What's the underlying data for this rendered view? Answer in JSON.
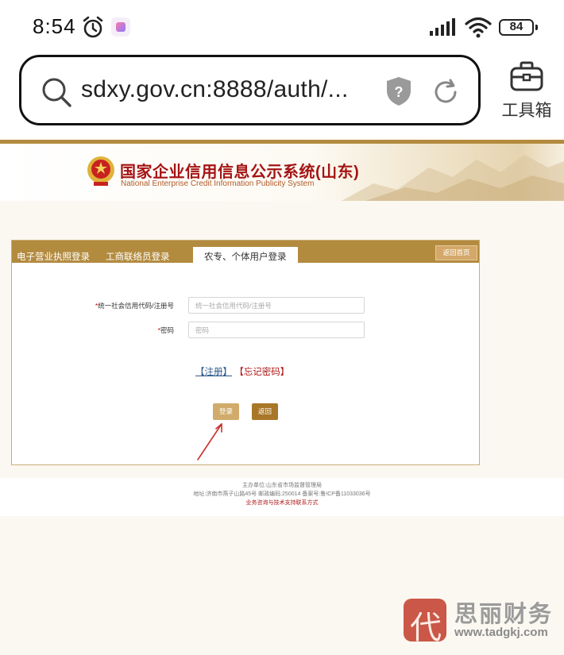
{
  "status_bar": {
    "time": "8:54",
    "battery": "84"
  },
  "browser": {
    "url": "sdxy.gov.cn:8888/auth/...",
    "toolbox_label": "工具箱"
  },
  "site": {
    "title": "国家企业信用信息公示系统(山东)",
    "subtitle": "National Enterprise Credit Information Publicity System"
  },
  "login": {
    "tabs": [
      "电子营业执照登录",
      "工商联络员登录",
      "农专、个体用户登录"
    ],
    "active_tab": 2,
    "home_button": "返回首页",
    "credit_code_label": "统一社会信用代码/注册号",
    "credit_code_placeholder": "统一社会信用代码/注册号",
    "password_label": "密码",
    "password_placeholder": "密码",
    "register_link": "【注册】",
    "forgot_link": "【忘记密码】",
    "login_button": "登录",
    "back_button": "返回"
  },
  "footer": {
    "sponsor": "主办单位:山东省市场监督管理局",
    "address": "地址:济南市燕子山路45号    邮政编码:250014    备案号:鲁ICP备11033036号",
    "support_link": "业务咨询与技术支持联系方式"
  },
  "watermark": {
    "name": "思丽财务",
    "url": "www.tadgkj.com",
    "seal_char": "代"
  },
  "colors": {
    "brand_gold": "#b38b3f",
    "title_red": "#a51414",
    "link_blue": "#2e5a8c"
  }
}
